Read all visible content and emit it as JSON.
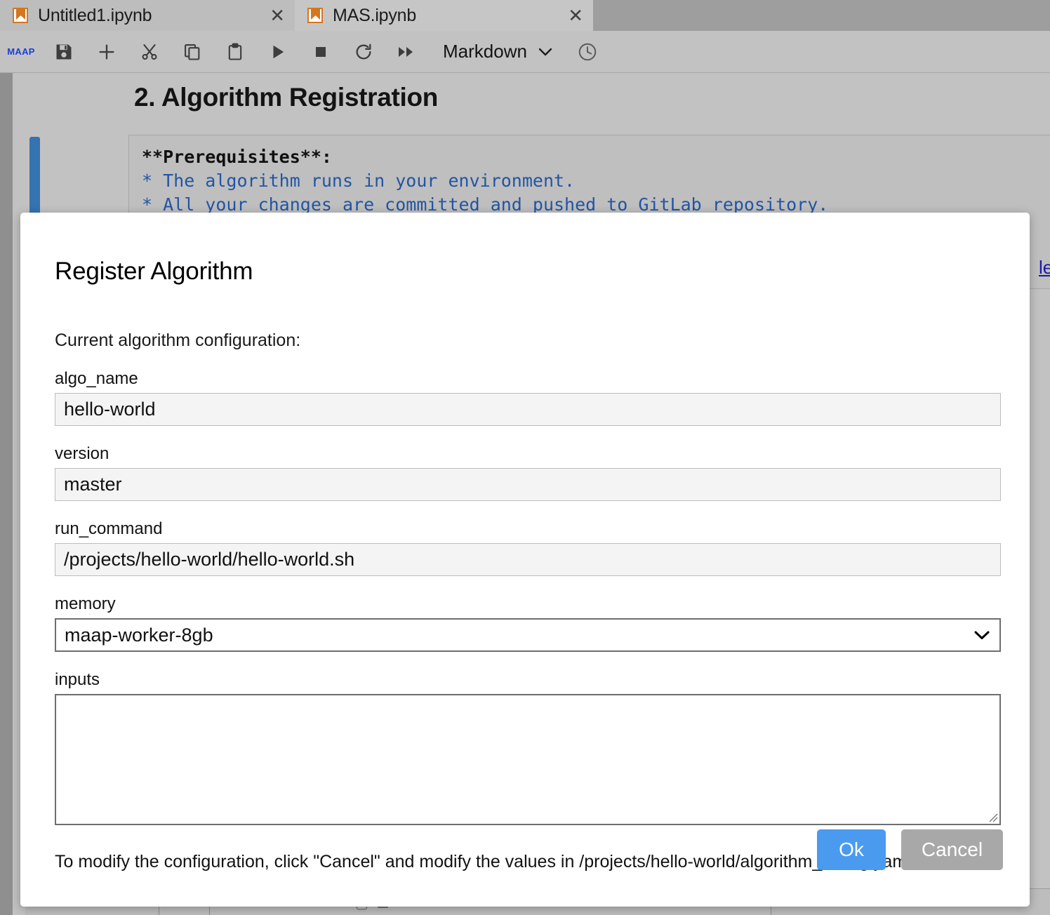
{
  "tabs": [
    {
      "label": "Untitled1.ipynb",
      "icon": "notebook-icon",
      "close": "✕",
      "active": false
    },
    {
      "label": "MAS.ipynb",
      "icon": "notebook-icon",
      "close": "✕",
      "active": true
    }
  ],
  "toolbar": {
    "brand": "MAAP",
    "items": [
      {
        "name": "save-icon",
        "title": "Save"
      },
      {
        "name": "add-cell-icon",
        "title": "Insert cell"
      },
      {
        "name": "cut-icon",
        "title": "Cut"
      },
      {
        "name": "copy-icon",
        "title": "Copy"
      },
      {
        "name": "paste-icon",
        "title": "Paste"
      },
      {
        "name": "run-icon",
        "title": "Run"
      },
      {
        "name": "stop-icon",
        "title": "Stop"
      },
      {
        "name": "restart-icon",
        "title": "Restart"
      },
      {
        "name": "restart-run-all-icon",
        "title": "Restart and run all"
      }
    ],
    "cell_type": "Markdown",
    "clock_icon": "clock-icon"
  },
  "notebook": {
    "heading": "2. Algorithm Registration",
    "markdown_lines": [
      "**Prerequisites**:",
      "* The algorithm runs in your environment.",
      "* All your changes are committed and pushed to GitLab repository."
    ],
    "right_link": "le"
  },
  "dialog": {
    "title": "Register Algorithm",
    "subtitle": "Current algorithm configuration:",
    "fields": [
      {
        "label": "algo_name",
        "value": "hello-world",
        "type": "text"
      },
      {
        "label": "version",
        "value": "master",
        "type": "text"
      },
      {
        "label": "run_command",
        "value": "/projects/hello-world/hello-world.sh",
        "type": "text"
      },
      {
        "label": "memory",
        "value": "maap-worker-8gb",
        "type": "select"
      },
      {
        "label": "inputs",
        "value": "",
        "type": "textarea"
      }
    ],
    "note": "To modify the configuration, click \"Cancel\" and modify the values in /projects/hello-world/algorithm_config.yaml",
    "ok_label": "Ok",
    "cancel_label": "Cancel"
  },
  "colors": {
    "accent_blue": "#4a9af0",
    "cancel_gray": "#a8a8a8",
    "cell_marker": "#3573b1",
    "brand_blue": "#1a3fd4",
    "tab_icon_orange": "#d4761f"
  }
}
